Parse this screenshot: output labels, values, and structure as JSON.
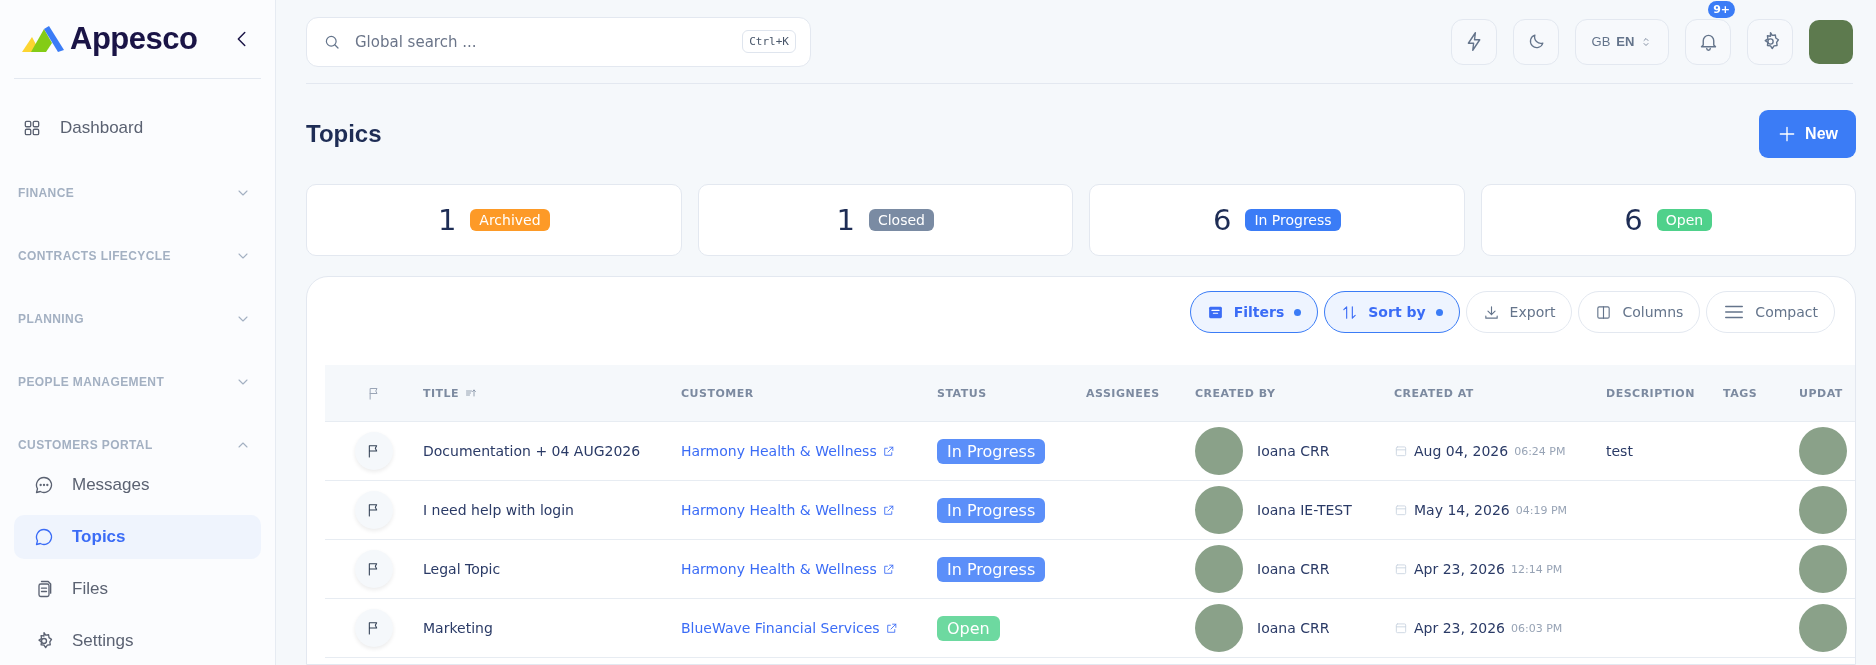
{
  "sidebar": {
    "logo": "Appesco",
    "items": [
      {
        "kind": "link",
        "label": "Dashboard",
        "selected": false
      },
      {
        "kind": "section",
        "label": "FINANCE",
        "expanded": false
      },
      {
        "kind": "section",
        "label": "CONTRACTS LIFECYCLE",
        "expanded": false
      },
      {
        "kind": "section",
        "label": "PLANNING",
        "expanded": false
      },
      {
        "kind": "section",
        "label": "PEOPLE MANAGEMENT",
        "expanded": false
      },
      {
        "kind": "section",
        "label": "CUSTOMERS PORTAL",
        "expanded": true,
        "children": [
          {
            "label": "Messages",
            "selected": false
          },
          {
            "label": "Topics",
            "selected": true
          },
          {
            "label": "Files",
            "selected": false
          },
          {
            "label": "Settings",
            "selected": false
          }
        ]
      }
    ]
  },
  "topbar": {
    "search": {
      "placeholder": "Global search ...",
      "shortcut": "Ctrl+K"
    },
    "language": {
      "country": "GB",
      "code": "EN"
    },
    "notifications_badge": "9+"
  },
  "page": {
    "title": "Topics",
    "new_button": "New"
  },
  "stats": [
    {
      "count": "1",
      "label": "Archived",
      "color": "#fd9a27"
    },
    {
      "count": "1",
      "label": "Closed",
      "color": "#7a8ba3"
    },
    {
      "count": "6",
      "label": "In Progress",
      "color": "#3b7cf6"
    },
    {
      "count": "6",
      "label": "Open",
      "color": "#4fd18b"
    }
  ],
  "toolbar": [
    {
      "label": "Filters",
      "kind": "filter",
      "active": true
    },
    {
      "label": "Sort by",
      "kind": "sort",
      "active": true
    },
    {
      "label": "Export",
      "kind": "export",
      "active": false
    },
    {
      "label": "Columns",
      "kind": "columns",
      "active": false
    },
    {
      "label": "Compact",
      "kind": "density",
      "active": false
    }
  ],
  "table": {
    "columns": [
      {
        "label": "TITLE",
        "sorted": true
      },
      {
        "label": "CUSTOMER",
        "sorted": false
      },
      {
        "label": "STATUS",
        "sorted": false
      },
      {
        "label": "ASSIGNEES",
        "sorted": false
      },
      {
        "label": "CREATED BY",
        "sorted": false
      },
      {
        "label": "CREATED AT",
        "sorted": false
      },
      {
        "label": "DESCRIPTION",
        "sorted": false
      },
      {
        "label": "TAGS",
        "sorted": false
      },
      {
        "label": "UPDAT",
        "sorted": false
      }
    ],
    "rows": [
      {
        "title": "Documentation + 04 AUG2026",
        "customer": "Harmony Health & Wellness",
        "status": "In Progress",
        "color": "#5b8ff9",
        "created_by": "Ioana CRR",
        "created_date": "Aug 04, 2026",
        "created_time": "06:24 PM",
        "description": "test"
      },
      {
        "title": "I need help with login",
        "customer": "Harmony Health & Wellness",
        "status": "In Progress",
        "color": "#5b8ff9",
        "created_by": "Ioana IE-TEST",
        "created_date": "May 14, 2026",
        "created_time": "04:19 PM"
      },
      {
        "title": "Legal Topic",
        "customer": "Harmony Health & Wellness",
        "status": "In Progress",
        "color": "#5b8ff9",
        "created_by": "Ioana CRR",
        "created_date": "Apr 23, 2026",
        "created_time": "12:14 PM"
      },
      {
        "title": "Marketing",
        "customer": "BlueWave Financial Services",
        "status": "Open",
        "color": "#6dd9a0",
        "created_by": "Ioana CRR",
        "created_date": "Apr 23, 2026",
        "created_time": "06:03 PM"
      }
    ]
  }
}
